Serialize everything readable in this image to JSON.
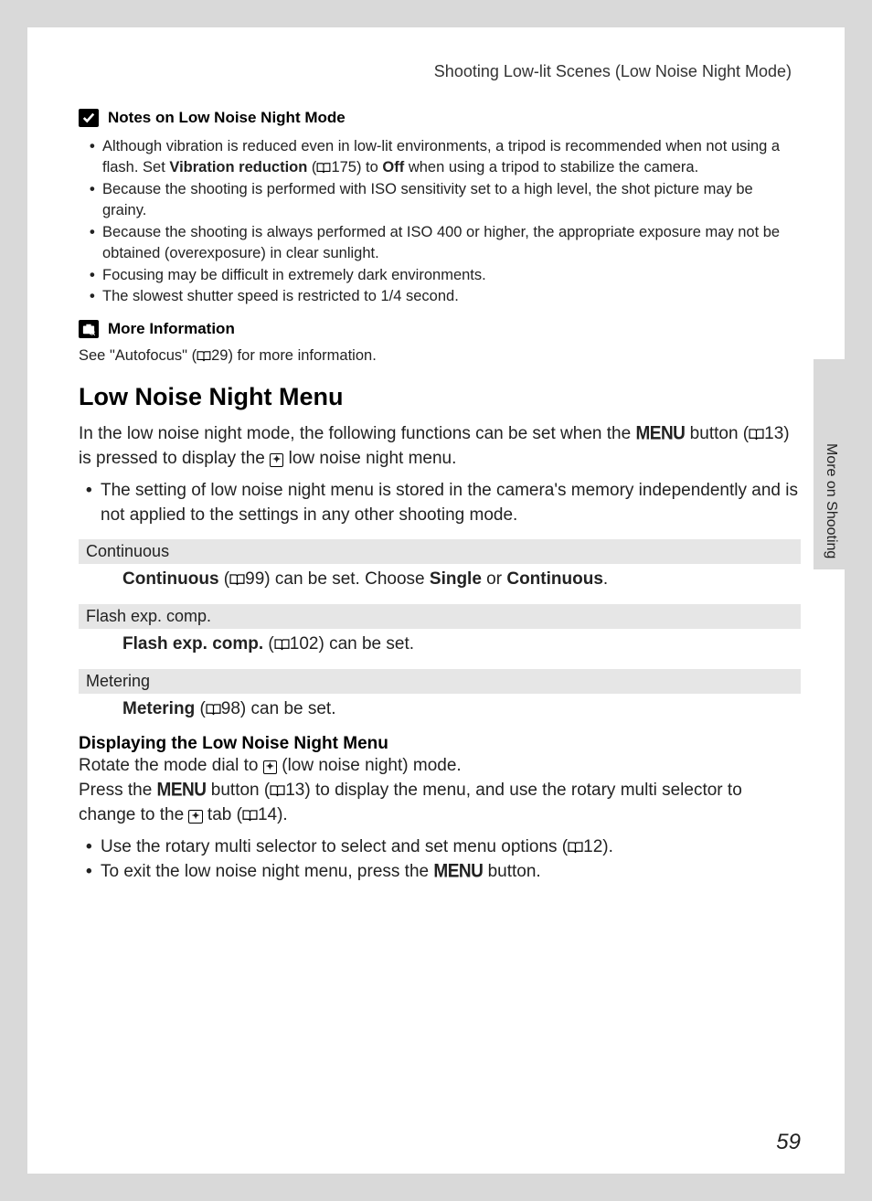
{
  "header": "Shooting Low-lit Scenes (Low Noise Night Mode)",
  "notes": {
    "title": "Notes on Low Noise Night Mode",
    "items": {
      "b1a": "Although vibration is reduced even in low-lit environments, a tripod is recommended when not using a flash. Set ",
      "b1b": "Vibration reduction",
      "b1c": " (",
      "b1d": "175) to ",
      "b1e": "Off",
      "b1f": " when using a tripod to stabilize the camera.",
      "b2": "Because the shooting is performed with ISO sensitivity set to a high level, the shot picture may be grainy.",
      "b3": "Because the shooting is always performed at ISO 400 or higher, the appropriate exposure may not be obtained (overexposure) in clear sunlight.",
      "b4": "Focusing may be difficult in extremely dark environments.",
      "b5": "The slowest shutter speed is restricted to 1/4 second."
    }
  },
  "moreInfo": {
    "title": "More Information",
    "text_a": "See \"Autofocus\" (",
    "text_b": "29) for more information."
  },
  "section": {
    "heading": "Low Noise Night Menu",
    "intro_a": "In the low noise night mode, the following functions can be set when the ",
    "intro_b": " button (",
    "intro_c": "13) is pressed to display the ",
    "intro_d": " low noise night menu.",
    "bullet1": "The setting of low noise night menu is stored in the camera's memory independently and is not applied to the settings in any other shooting mode."
  },
  "menus": {
    "continuous": {
      "label": "Continuous",
      "desc_a": "Continuous",
      "desc_b": " (",
      "desc_c": "99) can be set. Choose ",
      "desc_d": "Single",
      "desc_e": " or ",
      "desc_f": "Continuous",
      "desc_g": "."
    },
    "flash": {
      "label": "Flash exp. comp.",
      "desc_a": "Flash exp. comp.",
      "desc_b": " (",
      "desc_c": "102) can be set."
    },
    "metering": {
      "label": "Metering",
      "desc_a": "Metering",
      "desc_b": " (",
      "desc_c": "98) can be set."
    }
  },
  "display": {
    "heading": "Displaying the Low Noise Night Menu",
    "line1_a": "Rotate the mode dial to ",
    "line1_b": " (low noise night) mode.",
    "line2_a": "Press the ",
    "line2_b": " button (",
    "line2_c": "13) to display the menu, and use the rotary multi selector to change to the ",
    "line2_d": " tab (",
    "line2_e": "14).",
    "bullet1_a": "Use the rotary multi selector to select and set menu options (",
    "bullet1_b": "12).",
    "bullet2_a": "To exit the low noise night menu, press the ",
    "bullet2_b": " button."
  },
  "sideTab": "More on Shooting",
  "pageNumber": "59",
  "glyphs": {
    "menu": "MENU",
    "mode": "◙"
  }
}
